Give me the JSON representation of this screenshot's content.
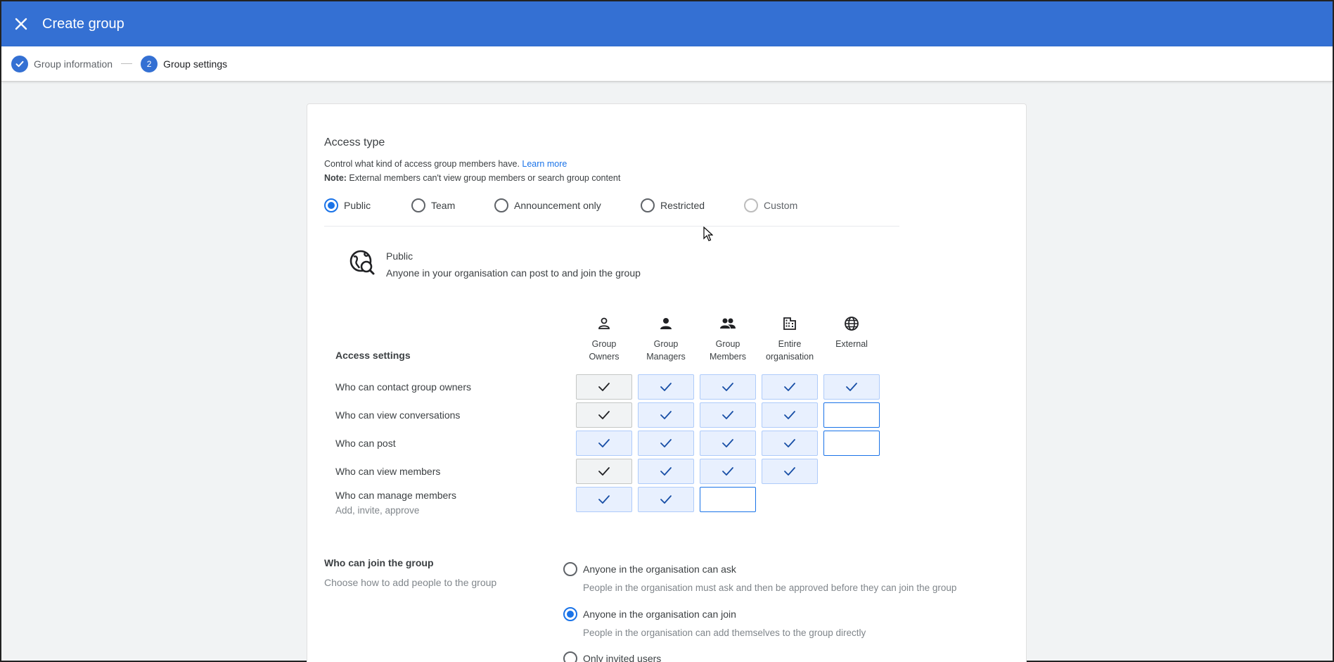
{
  "header": {
    "title": "Create group"
  },
  "stepper": {
    "steps": [
      {
        "label": "Group information",
        "state": "complete"
      },
      {
        "number": "2",
        "label": "Group settings",
        "state": "active"
      }
    ]
  },
  "access_type": {
    "title": "Access type",
    "description": "Control what kind of access group members have.",
    "learn_more": "Learn more",
    "note_label": "Note:",
    "note_text": " External members can't view group members or search group content",
    "options": [
      {
        "label": "Public",
        "selected": true
      },
      {
        "label": "Team",
        "selected": false
      },
      {
        "label": "Announcement only",
        "selected": false
      },
      {
        "label": "Restricted",
        "selected": false
      },
      {
        "label": "Custom",
        "selected": false,
        "disabled": true
      }
    ],
    "summary": {
      "title": "Public",
      "description": "Anyone in your organisation can post to and join the group",
      "icon": "public-search-icon"
    }
  },
  "access_settings": {
    "title": "Access settings",
    "columns": [
      {
        "line1": "Group",
        "line2": "Owners",
        "icon": "person-outline-icon"
      },
      {
        "line1": "Group",
        "line2": "Managers",
        "icon": "person-icon"
      },
      {
        "line1": "Group",
        "line2": "Members",
        "icon": "people-icon"
      },
      {
        "line1": "Entire",
        "line2": "organisation",
        "icon": "building-icon"
      },
      {
        "line1": "External",
        "line2": "",
        "icon": "globe-icon"
      }
    ],
    "rows": [
      {
        "label": "Who can contact group owners",
        "sub": "",
        "cells": [
          "fixed",
          "on",
          "on",
          "on",
          "on"
        ]
      },
      {
        "label": "Who can view conversations",
        "sub": "",
        "cells": [
          "fixed",
          "on",
          "on",
          "on",
          "off"
        ]
      },
      {
        "label": "Who can post",
        "sub": "",
        "cells": [
          "on",
          "on",
          "on",
          "on",
          "off"
        ]
      },
      {
        "label": "Who can view members",
        "sub": "",
        "cells": [
          "fixed",
          "on",
          "on",
          "on",
          "none"
        ]
      },
      {
        "label": "Who can manage members",
        "sub": "Add, invite, approve",
        "cells": [
          "on",
          "on",
          "off",
          "none",
          "none"
        ]
      }
    ]
  },
  "join": {
    "title": "Who can join the group",
    "description": "Choose how to add people to the group",
    "options": [
      {
        "label": "Anyone in the organisation can ask",
        "sub": "People in the organisation must ask and then be approved before they can join the group",
        "selected": false
      },
      {
        "label": "Anyone in the organisation can join",
        "sub": "People in the organisation can add themselves to the group directly",
        "selected": true
      },
      {
        "label": "Only invited users",
        "sub": "",
        "selected": false
      }
    ]
  },
  "colors": {
    "primary": "#3470d3",
    "accent": "#1a73e8",
    "cell_on": "#e8f0fe"
  }
}
